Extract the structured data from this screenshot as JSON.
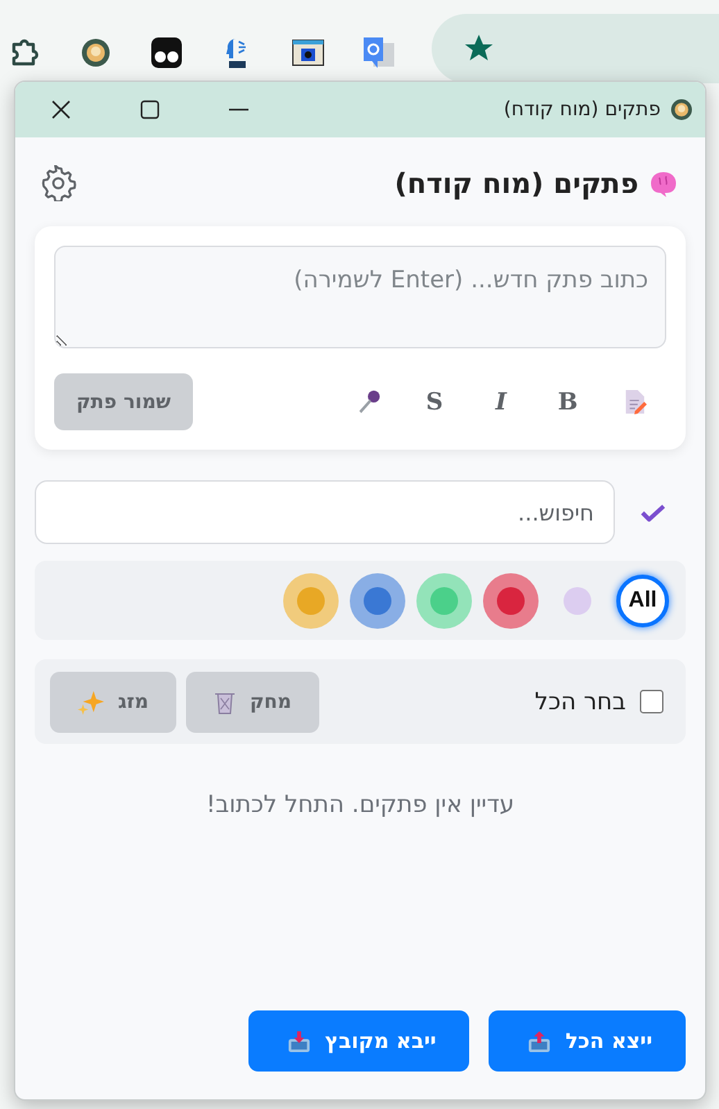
{
  "browser_toolbar": {
    "icons": [
      {
        "kind": "puzzle"
      },
      {
        "kind": "badge"
      },
      {
        "kind": "eyes"
      },
      {
        "kind": "ai"
      },
      {
        "kind": "camera"
      },
      {
        "kind": "translate"
      }
    ],
    "bookmark": {
      "kind": "star"
    }
  },
  "window": {
    "title": "פתקים (מוח קודח)"
  },
  "header": {
    "title": "פתקים (מוח קודח)"
  },
  "editor": {
    "placeholder": "כתוב פתק חדש... (Enter לשמירה)",
    "tools": [
      {
        "kind": "note"
      },
      {
        "kind": "bold",
        "label": "B"
      },
      {
        "kind": "italic",
        "label": "I"
      },
      {
        "kind": "strike",
        "label": "S"
      },
      {
        "kind": "mic"
      }
    ],
    "save_button": {
      "label": "שמור פתק",
      "disabled": true
    }
  },
  "search": {
    "placeholder": "חיפוש..."
  },
  "color_filters": [
    {
      "kind": "all",
      "label": "All",
      "selected": true
    },
    {
      "kind": "plain",
      "color": "#dccdf0",
      "selected": false
    },
    {
      "kind": "swatch",
      "color": "#d9253f",
      "selected": false
    },
    {
      "kind": "swatch",
      "color": "#4bd08a",
      "selected": false
    },
    {
      "kind": "swatch",
      "color": "#3a78d4",
      "selected": false
    },
    {
      "kind": "swatch",
      "color": "#e8a825",
      "selected": false
    }
  ],
  "bulk": {
    "select_all": {
      "label": "בחר הכל",
      "checked": false
    },
    "delete_button": {
      "label": "מחק",
      "disabled": true
    },
    "merge_button": {
      "label": "מזג",
      "disabled": true
    }
  },
  "empty_message": "עדיין אין פתקים. התחל לכתוב!",
  "footer_buttons": [
    {
      "kind": "export",
      "label": "ייצא הכל"
    },
    {
      "kind": "import",
      "label": "ייבא מקובץ"
    }
  ]
}
